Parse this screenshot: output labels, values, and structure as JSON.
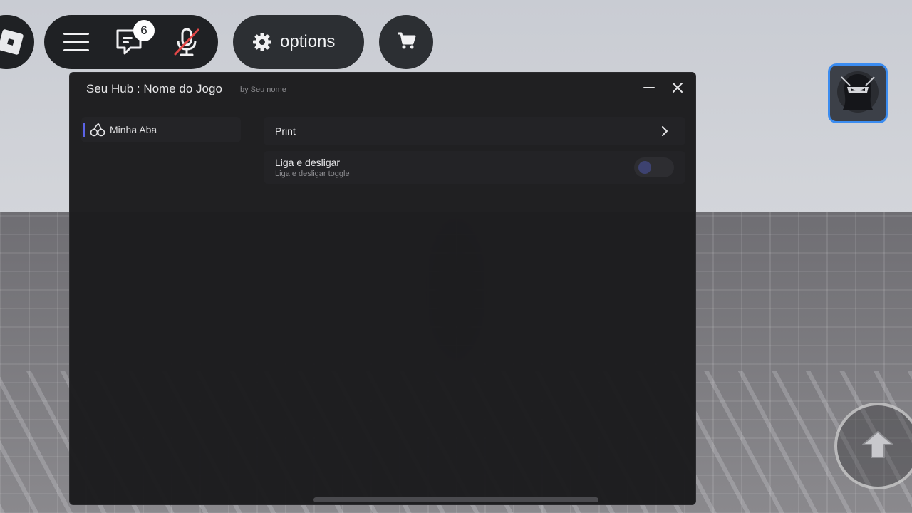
{
  "topbar": {
    "chat_badge_count": "6",
    "options_label": "options",
    "icons": [
      "roblox-logo-icon",
      "hamburger-menu-icon",
      "chat-icon",
      "mic-muted-icon",
      "gear-icon",
      "cart-icon"
    ]
  },
  "hub": {
    "title": "Seu Hub : Nome do Jogo",
    "subtitle": "by Seu nome",
    "tabs": [
      {
        "label": "Minha Aba",
        "icon": "cherries-icon",
        "selected": true
      }
    ],
    "elements": {
      "print_button": {
        "label": "Print"
      },
      "toggle": {
        "label": "Liga e desligar",
        "description": "Liga e desligar toggle",
        "state": "off"
      }
    },
    "accent_color": "#5b63e6"
  },
  "colors": {
    "avatar_border": "#3b8cf0",
    "mic_slash": "#e24747"
  }
}
